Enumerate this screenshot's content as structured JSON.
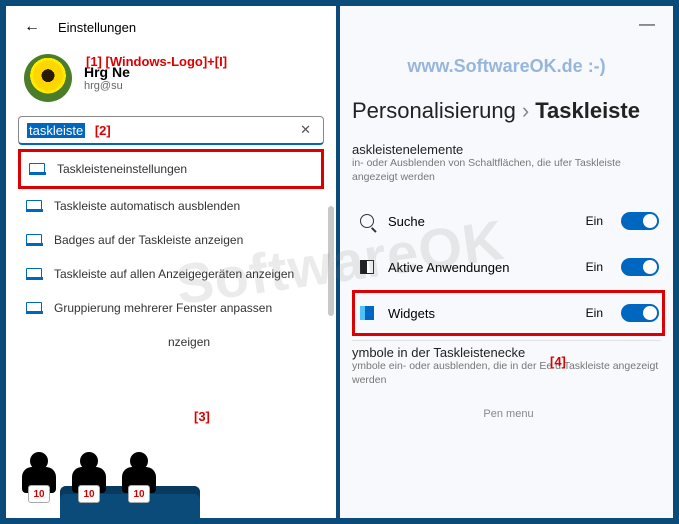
{
  "left": {
    "title": "Einstellungen",
    "annotation1": "[1] [Windows-Logo]+[I]",
    "profile": {
      "name": "Hrg Ne",
      "email": "hrg@su"
    },
    "search": {
      "value": "taskleiste",
      "annotation2": "[2]"
    },
    "results": [
      "Taskleisteneinstellungen",
      "Taskleiste automatisch ausblenden",
      "Badges auf der Taskleiste anzeigen",
      "Taskleiste auf allen Anzeigegeräten anzeigen",
      "Gruppierung mehrerer Fenster anpassen",
      "nzeigen"
    ],
    "annotation3": "[3]"
  },
  "right": {
    "watermark_url": "www.SoftwareOK.de :-)",
    "breadcrumb": {
      "parent": "Personalisierung",
      "current": "Taskleiste"
    },
    "section1": {
      "title": "askleistenelemente",
      "desc": "in- oder Ausblenden von Schaltflächen, die ufer Taskleiste angezeigt werden"
    },
    "toggles": [
      {
        "label": "Suche",
        "state": "Ein"
      },
      {
        "label": "Aktive Anwendungen",
        "state": "Ein"
      },
      {
        "label": "Widgets",
        "state": "Ein"
      }
    ],
    "annotation4": "[4]",
    "section2": {
      "title": "ymbole in der Taskleistenecke",
      "desc": "ymbole ein- oder ausblenden, die in der Ee d Taskleiste angezeigt werden"
    },
    "pen": "Pen menu"
  },
  "watermark_big": "SoftwareOK",
  "figure_sign": "10"
}
